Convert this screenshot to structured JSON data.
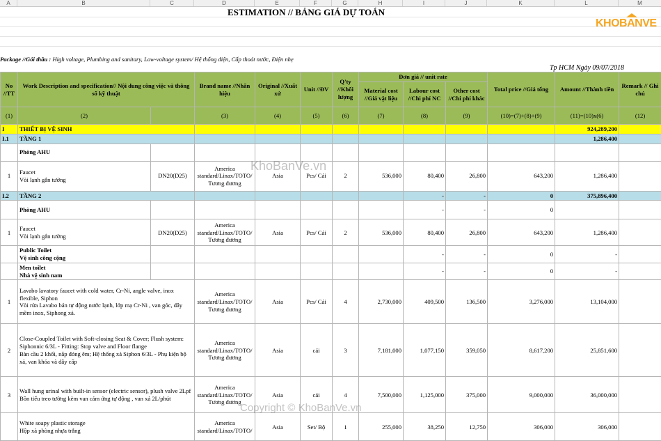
{
  "column_letters": [
    "A",
    "B",
    "C",
    "D",
    "E",
    "F",
    "G",
    "H",
    "I",
    "J",
    "K",
    "L",
    "M"
  ],
  "title": "ESTIMATION // BẢNG GIÁ DỰ TOÁN",
  "logo_text": "KHOBANVE",
  "package_label": "Package //Gói thầu :",
  "package_text": "High voltage, Plumbing and sanitary,  Low-voltage system/ Hệ thống điện, Cấp thoát nước, Điện nhẹ",
  "date_text": "Tp HCM Ngày 09/07/2018",
  "header": {
    "no": "No //TT",
    "work": "Work Description and specification// Nội dung công việc và thông số kỹ thuật",
    "brand": "Brand name //Nhãn hiệu",
    "origin": "Original //Xuất xứ",
    "unit": "Unit //ĐV",
    "qty": "Q'ty //Khối lượng",
    "unit_rate": "Đơn giá // unit rate",
    "material": "Material cost //Giá vật liệu",
    "labour": "Labour cost //Chi phí NC",
    "other": "Other cost //Chi phí khác",
    "total": "Total price //Giá tổng",
    "amount": "Amount //Thành tiền",
    "remark": "Remark // Ghi chú"
  },
  "index_row": [
    "(1)",
    "(2)",
    "",
    "(3)",
    "(4)",
    "(5)",
    "(6)",
    "(7)",
    "(8)",
    "(9)",
    "(10)=(7)+(8)+(9)",
    "(11)=(10)x(6)",
    "(12)"
  ],
  "rows": {
    "r1": {
      "no": "I",
      "desc": "THIẾT BỊ VỆ SINH",
      "amount": "924,289,200"
    },
    "r2": {
      "no": "I.1",
      "desc": "TẦNG 1",
      "amount": "1,286,400"
    },
    "r3": {
      "desc": "Phòng AHU"
    },
    "r4": {
      "no": "1",
      "desc": "Faucet\nVòi lạnh gắn tường",
      "size": "DN20(D25)",
      "brand": "America standard/Linax/TOTO/ Tương đương",
      "origin": "Asia",
      "unit": "Pcs/ Cái",
      "qty": "2",
      "material": "536,000",
      "labour": "80,400",
      "other": "26,800",
      "total": "643,200",
      "amount": "1,286,400"
    },
    "r5": {
      "no": "I.2",
      "desc": "TẦNG 2",
      "labour": "-",
      "other": "-",
      "total": "0",
      "amount": "375,896,400"
    },
    "r6": {
      "desc": "Phòng AHU",
      "labour": "-",
      "other": "-",
      "total": "0"
    },
    "r7": {
      "no": "1",
      "desc": "Faucet\nVòi lạnh gắn tường",
      "size": "DN20(D25)",
      "brand": "America standard/Linax/TOTO/ Tương đương",
      "origin": "Asia",
      "unit": "Pcs/ Cái",
      "qty": "2",
      "material": "536,000",
      "labour": "80,400",
      "other": "26,800",
      "total": "643,200",
      "amount": "1,286,400"
    },
    "r8": {
      "desc": "Public Toilet\nVệ sinh công cộng",
      "labour": "-",
      "other": "-",
      "total": "0",
      "amount": "-"
    },
    "r9": {
      "desc": "Men toilet\nNhà vệ sinh nam",
      "labour": "-",
      "other": "-",
      "total": "0",
      "amount": "-"
    },
    "r10": {
      "no": "1",
      "desc": "Lavabo lavatory faucet with cold water, Cr-Ni, angle valve, inox flexible, Siphon\nVòi rửa Lavabo bán tự động nước lạnh, lớp mạ Cr-Ni , van góc, dây mềm inox, Siphong xả.",
      "brand": "America standard/Linax/TOTO/ Tương đương",
      "origin": "Asia",
      "unit": "Pcs/ Cái",
      "qty": "4",
      "material": "2,730,000",
      "labour": "409,500",
      "other": "136,500",
      "total": "3,276,000",
      "amount": "13,104,000"
    },
    "r11": {
      "no": "2",
      "desc": "Close-Coupled Toilet with Soft-closing Seat & Cover; Flush system: Siphonnic 6/3L - Fitting: Stop valve and Floor flange\nBàn cầu 2 khối, nắp đóng êm; Hệ thống xả Siphon 6/3L -  Phụ kiện bộ xả, van khóa và dây cấp",
      "brand": "America standard/Linax/TOTO/ Tương đương",
      "origin": "Asia",
      "unit": "cái",
      "qty": "3",
      "material": "7,181,000",
      "labour": "1,077,150",
      "other": "359,050",
      "total": "8,617,200",
      "amount": "25,851,600"
    },
    "r12": {
      "no": "3",
      "desc": "Wall hung urinal with built-in sensor (electric sensor), plush valve 2Lpf\nBồn tiểu treo tường kèm van cảm ứng tự động , van xả 2L/phút",
      "brand": "America standard/Linax/TOTO/ Tương đương",
      "origin": "Asia",
      "unit": "cái",
      "qty": "4",
      "material": "7,500,000",
      "labour": "1,125,000",
      "other": "375,000",
      "total": "9,000,000",
      "amount": "36,000,000"
    },
    "r13": {
      "desc": "White soapy plastic storage\nHộp xà phòng nhựa trắng",
      "brand": "America standard/Linax/TOTO/",
      "origin": "Asia",
      "unit": "Set/ Bộ",
      "qty": "1",
      "material": "255,000",
      "labour": "38,250",
      "other": "12,750",
      "total": "306,000",
      "amount": "306,000"
    }
  },
  "watermarks": [
    "KhoBanVe.vn",
    "Copyright © KhoBanVe.vn"
  ]
}
